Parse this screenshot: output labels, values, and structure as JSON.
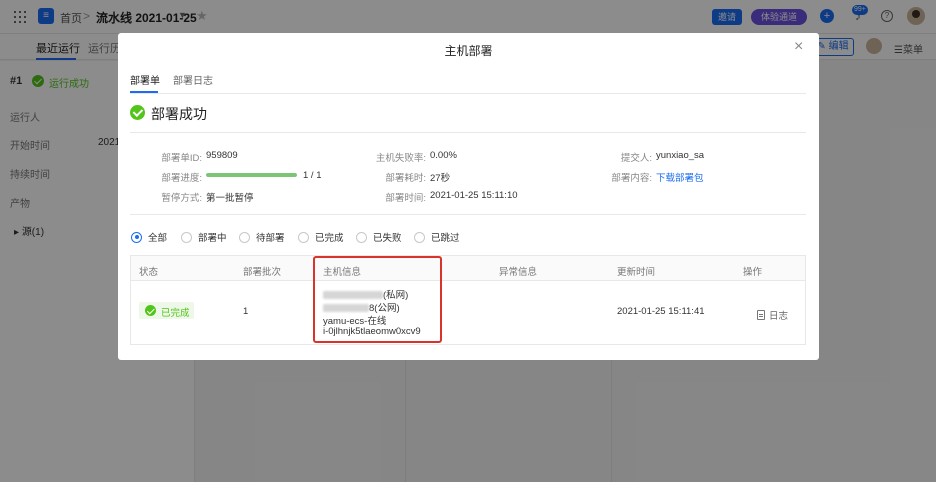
{
  "topbar": {
    "breadcrumb_home": "首页",
    "breadcrumb_sep": ">",
    "pipeline_name": "流水线 2021-01-25",
    "invite_label": "邀请",
    "trial_label": "体验通道",
    "notification_count": "99+"
  },
  "subnav": {
    "tab_recent": "最近运行",
    "tab_history": "运行历",
    "edit_label": "编辑",
    "menu_label": "菜单"
  },
  "sidebar": {
    "run_number": "#1",
    "run_status": "运行成功",
    "labels": [
      "运行人",
      "开始时间",
      "持续时间",
      "产物"
    ],
    "start_value": "2021",
    "source": "源(1)"
  },
  "modal": {
    "title": "主机部署",
    "tabs": [
      "部署单",
      "部署日志"
    ],
    "result_title": "部署成功",
    "info": {
      "deploy_id_label": "部署单ID:",
      "deploy_id": "959809",
      "progress_label": "部署进度:",
      "progress_text": "1 / 1",
      "progress_fraction": 1.0,
      "pause_label": "暂停方式:",
      "pause_value": "第一批暂停",
      "fail_rate_label": "主机失败率:",
      "fail_rate": "0.00%",
      "duration_label": "部署耗时:",
      "duration": "27秒",
      "time_label": "部署时间:",
      "time": "2021-01-25 15:11:10",
      "submitter_label": "提交人:",
      "submitter": "yunxiao_sa",
      "content_label": "部署内容:",
      "content_link": "下载部署包"
    },
    "filters": [
      "全部",
      "部署中",
      "待部署",
      "已完成",
      "已失败",
      "已跳过"
    ],
    "table": {
      "headers": [
        "状态",
        "部署批次",
        "主机信息",
        "异常信息",
        "更新时间",
        "操作"
      ],
      "row": {
        "status": "已完成",
        "batch": "1",
        "host_private_suffix": "(私网)",
        "host_public_tail": "8",
        "host_public_suffix": "(公网)",
        "host_name": "yamu-ecs-在线",
        "host_id": "i-0jlhnjk5tlaeomw0xcv9",
        "updated": "2021-01-25 15:11:41",
        "action": "日志"
      }
    }
  }
}
